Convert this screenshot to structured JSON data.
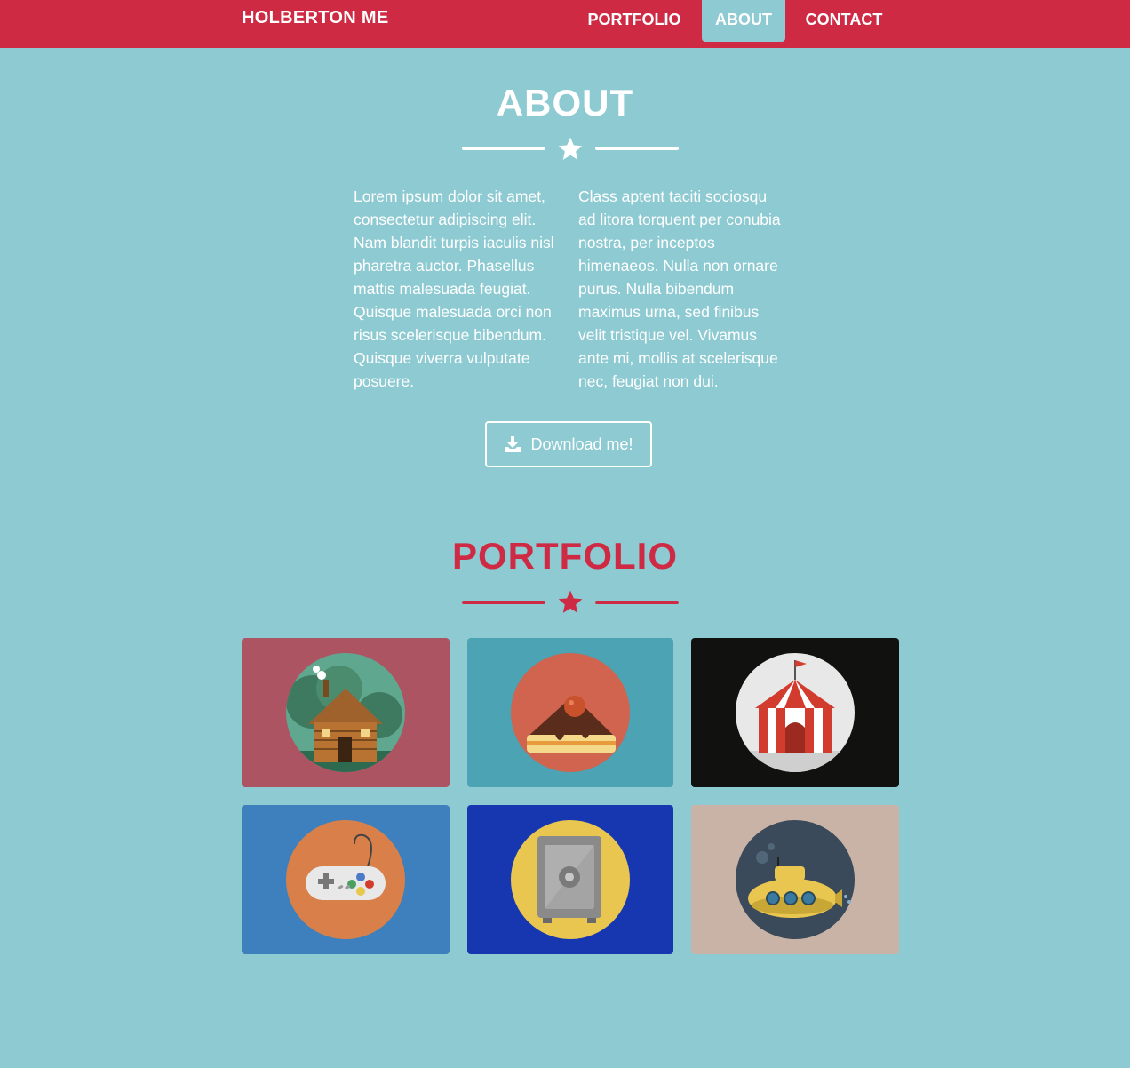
{
  "nav": {
    "brand": "HOLBERTON ME",
    "links": [
      {
        "label": "PORTFOLIO"
      },
      {
        "label": "ABOUT",
        "active": true
      },
      {
        "label": "CONTACT"
      }
    ]
  },
  "about": {
    "title": "ABOUT",
    "col_left": "Lorem ipsum dolor sit amet, consectetur adipiscing elit. Nam blandit turpis iaculis nisl pharetra auctor. Phasellus mattis malesuada feugiat. Quisque malesuada orci non risus scelerisque bibendum. Quisque viverra vulputate posuere.",
    "col_right": "Class aptent taciti sociosqu ad litora torquent per conubia nostra, per inceptos himenaeos. Nulla non ornare purus. Nulla bibendum maximus urna, sed finibus velit tristique vel. Vivamus ante mi, mollis at scelerisque nec, feugiat non dui.",
    "download_label": "Download me!"
  },
  "portfolio": {
    "title": "PORTFOLIO",
    "items": [
      {
        "icon": "cabin-icon",
        "bg": "#ad5463"
      },
      {
        "icon": "cake-icon",
        "bg": "#4ba3b3"
      },
      {
        "icon": "circus-tent-icon",
        "bg": "#111110"
      },
      {
        "icon": "game-controller-icon",
        "bg": "#3d80bd"
      },
      {
        "icon": "safe-icon",
        "bg": "#1737b0"
      },
      {
        "icon": "submarine-icon",
        "bg": "#c9b3a6"
      }
    ]
  },
  "colors": {
    "brand_red": "#cf2a44",
    "background": "#8ecad2",
    "text_white": "#ffffff"
  }
}
